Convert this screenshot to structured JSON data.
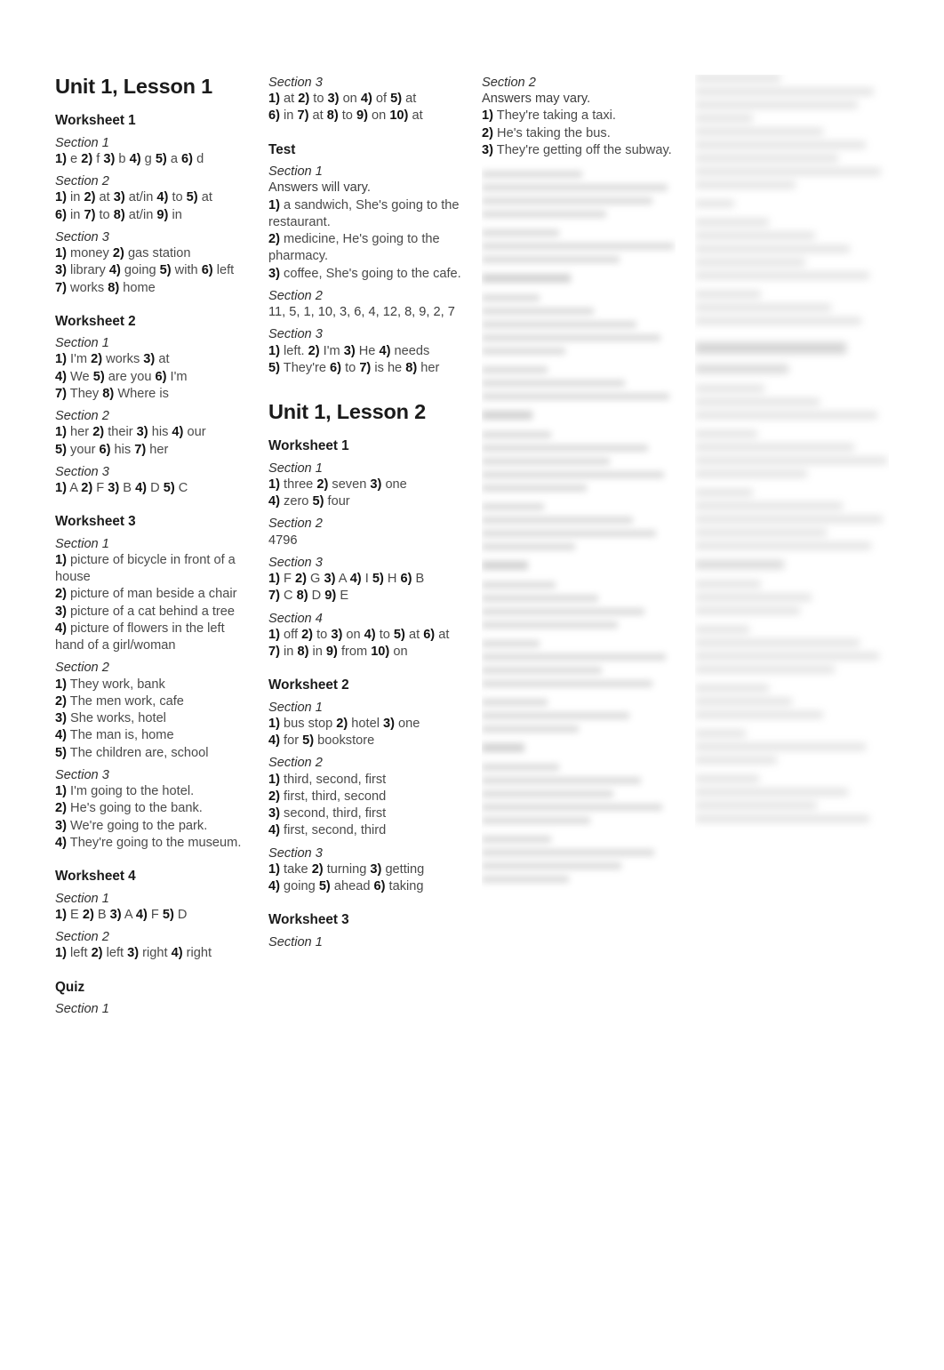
{
  "page": {
    "background": "#ffffff",
    "text_color": "#4a4a4a",
    "heading_color": "#1a1a1a"
  },
  "columns": [
    {
      "id": "column-1",
      "blocks": [
        {
          "type": "unit",
          "text": "Unit 1, Lesson 1"
        },
        {
          "type": "worksheet",
          "text": "Worksheet 1"
        },
        {
          "type": "section",
          "text": "Section 1"
        },
        {
          "type": "answers",
          "lines": [
            "1) e 2) f 3) b 4) g 5) a 6) d"
          ]
        },
        {
          "type": "section",
          "text": "Section 2"
        },
        {
          "type": "answers",
          "lines": [
            "1) in 2) at 3) at/in 4) to 5) at",
            "6) in 7) to 8) at/in 9) in"
          ]
        },
        {
          "type": "section",
          "text": "Section 3"
        },
        {
          "type": "answers",
          "lines": [
            "1) money 2) gas station",
            "3) library 4) going 5) with 6) left",
            "7) works 8) home"
          ]
        },
        {
          "type": "worksheet",
          "text": "Worksheet 2"
        },
        {
          "type": "section",
          "text": "Section 1"
        },
        {
          "type": "answers",
          "lines": [
            "1) I'm 2) works 3) at",
            "4) We 5) are you 6) I'm",
            "7) They 8) Where is"
          ]
        },
        {
          "type": "section",
          "text": "Section 2"
        },
        {
          "type": "answers",
          "lines": [
            "1) her 2) their 3) his 4) our",
            "5) your 6) his 7) her"
          ]
        },
        {
          "type": "section",
          "text": "Section 3"
        },
        {
          "type": "answers",
          "lines": [
            "1) A 2) F 3) B 4) D 5) C"
          ]
        },
        {
          "type": "worksheet",
          "text": "Worksheet 3"
        },
        {
          "type": "section",
          "text": "Section 1"
        },
        {
          "type": "answers",
          "lines": [
            "1) picture of bicycle in front of a house",
            "2) picture of man beside a chair",
            "3) picture of a cat behind a tree",
            "4) picture of flowers in the left hand of a girl/woman"
          ]
        },
        {
          "type": "section",
          "text": "Section 2"
        },
        {
          "type": "answers",
          "lines": [
            "1) They work, bank",
            "2) The men work, cafe",
            "3) She works, hotel",
            "4) The man is, home",
            "5) The children are, school"
          ]
        },
        {
          "type": "section",
          "text": "Section 3"
        },
        {
          "type": "answers",
          "lines": [
            "1) I'm going to the hotel.",
            "2) He's going to the bank.",
            "3) We're going to the park.",
            "4) They're going to the museum."
          ]
        },
        {
          "type": "worksheet",
          "text": "Worksheet 4"
        },
        {
          "type": "section",
          "text": "Section 1"
        },
        {
          "type": "answers",
          "lines": [
            "1) E 2) B 3) A 4) F 5) D"
          ]
        },
        {
          "type": "section",
          "text": "Section 2"
        },
        {
          "type": "answers",
          "lines": [
            "1) left 2) left 3) right 4) right"
          ]
        },
        {
          "type": "worksheet",
          "text": "Quiz"
        },
        {
          "type": "section",
          "text": "Section 1"
        }
      ]
    },
    {
      "id": "column-2",
      "blocks": [
        {
          "type": "section",
          "text": "Section 3"
        },
        {
          "type": "answers",
          "lines": [
            "1) at 2) to 3) on 4) of 5) at",
            "6) in 7) at 8) to 9) on 10) at"
          ]
        },
        {
          "type": "worksheet",
          "text": "Test"
        },
        {
          "type": "section",
          "text": "Section 1"
        },
        {
          "type": "plain",
          "lines": [
            "Answers will vary."
          ]
        },
        {
          "type": "answers",
          "lines": [
            "1) a sandwich, She's going to the restaurant.",
            "2) medicine, He's going to the pharmacy.",
            "3) coffee, She's going to the cafe."
          ]
        },
        {
          "type": "section",
          "text": "Section 2"
        },
        {
          "type": "plain",
          "lines": [
            "11, 5, 1, 10, 3, 6, 4, 12, 8, 9, 2, 7"
          ]
        },
        {
          "type": "section",
          "text": "Section 3"
        },
        {
          "type": "answers",
          "lines": [
            "1) left. 2) I'm 3) He 4) needs",
            "5) They're 6) to 7) is he 8) her"
          ]
        },
        {
          "type": "unit",
          "text": "Unit 1, Lesson 2"
        },
        {
          "type": "worksheet",
          "text": "Worksheet 1"
        },
        {
          "type": "section",
          "text": "Section 1"
        },
        {
          "type": "answers",
          "lines": [
            "1) three 2) seven 3) one",
            "4) zero 5) four"
          ]
        },
        {
          "type": "section",
          "text": "Section 2"
        },
        {
          "type": "plain",
          "lines": [
            "4796"
          ]
        },
        {
          "type": "section",
          "text": "Section 3"
        },
        {
          "type": "answers",
          "lines": [
            "1) F 2) G 3) A 4) I 5) H 6) B",
            "7) C 8) D 9) E"
          ]
        },
        {
          "type": "section",
          "text": "Section 4"
        },
        {
          "type": "answers",
          "lines": [
            "1) off 2) to 3) on 4) to 5) at 6) at",
            "7) in 8) in 9) from 10) on"
          ]
        },
        {
          "type": "worksheet",
          "text": "Worksheet 2"
        },
        {
          "type": "section",
          "text": "Section 1"
        },
        {
          "type": "answers",
          "lines": [
            "1) bus stop 2) hotel 3) one",
            "4) for 5) bookstore"
          ]
        },
        {
          "type": "section",
          "text": "Section 2"
        },
        {
          "type": "answers",
          "lines": [
            "1) third, second, first",
            "2) first, third, second",
            "3) second, third, first",
            "4) first, second, third"
          ]
        },
        {
          "type": "section",
          "text": "Section 3"
        },
        {
          "type": "answers",
          "lines": [
            "1) take 2) turning 3) getting",
            "4) going 5) ahead 6) taking"
          ]
        },
        {
          "type": "worksheet",
          "text": "Worksheet 3"
        },
        {
          "type": "section",
          "text": "Section 1"
        }
      ]
    },
    {
      "id": "column-3",
      "legible_blocks": [
        {
          "type": "section",
          "text": "Section 2"
        },
        {
          "type": "plain",
          "lines": [
            "Answers may vary."
          ]
        },
        {
          "type": "answers",
          "lines": [
            "1) They're taking a taxi.",
            "2) He's taking the bus.",
            "3) They're getting off the subway."
          ]
        }
      ],
      "blurred": true
    },
    {
      "id": "column-4",
      "legible_blocks": [],
      "blurred": true
    }
  ]
}
